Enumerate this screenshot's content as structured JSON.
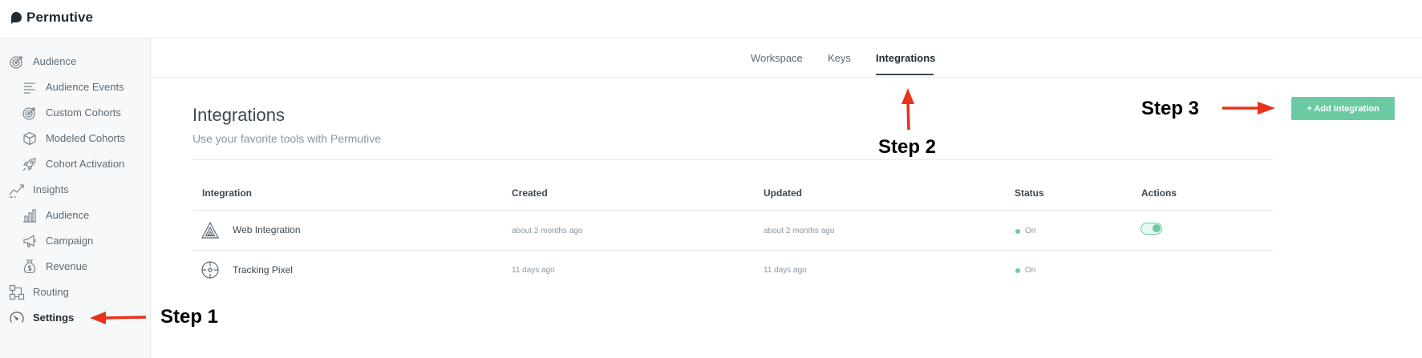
{
  "app": {
    "brand": "Permutive"
  },
  "sidebar": {
    "items": [
      {
        "label": "Audience",
        "icon": "target-icon",
        "level": "top"
      },
      {
        "label": "Audience Events",
        "icon": "lines-icon",
        "level": "sub"
      },
      {
        "label": "Custom Cohorts",
        "icon": "target-icon",
        "level": "sub"
      },
      {
        "label": "Modeled Cohorts",
        "icon": "cube-icon",
        "level": "sub"
      },
      {
        "label": "Cohort Activation",
        "icon": "rocket-icon",
        "level": "sub"
      },
      {
        "label": "Insights",
        "icon": "trend-icon",
        "level": "top"
      },
      {
        "label": "Audience",
        "icon": "bar-chart-icon",
        "level": "sub"
      },
      {
        "label": "Campaign",
        "icon": "megaphone-icon",
        "level": "sub"
      },
      {
        "label": "Revenue",
        "icon": "money-bag-icon",
        "level": "sub"
      },
      {
        "label": "Routing",
        "icon": "routing-icon",
        "level": "top"
      },
      {
        "label": "Settings",
        "icon": "gauge-icon",
        "level": "top",
        "active": true
      }
    ]
  },
  "tabs": [
    {
      "label": "Workspace"
    },
    {
      "label": "Keys"
    },
    {
      "label": "Integrations",
      "active": true
    }
  ],
  "page": {
    "title": "Integrations",
    "subtitle": "Use your favorite tools with Permutive",
    "add_button": "+ Add Integration"
  },
  "table": {
    "headers": [
      "Integration",
      "Created",
      "Updated",
      "Status",
      "Actions"
    ],
    "rows": [
      {
        "name": "Web Integration",
        "icon": "triangle-icon",
        "created": "about 2 months ago",
        "updated": "about 2 months ago",
        "status": "On",
        "toggle": true
      },
      {
        "name": "Tracking Pixel",
        "icon": "crosshair-icon",
        "created": "11 days ago",
        "updated": "11 days ago",
        "status": "On",
        "toggle": false
      }
    ]
  },
  "annotations": {
    "step1": "Step 1",
    "step2": "Step 2",
    "step3": "Step 3"
  },
  "colors": {
    "accent": "#6ccaa3",
    "annotation_arrow": "#e8321c",
    "text": "#3d4852",
    "muted": "#8a96a0"
  }
}
